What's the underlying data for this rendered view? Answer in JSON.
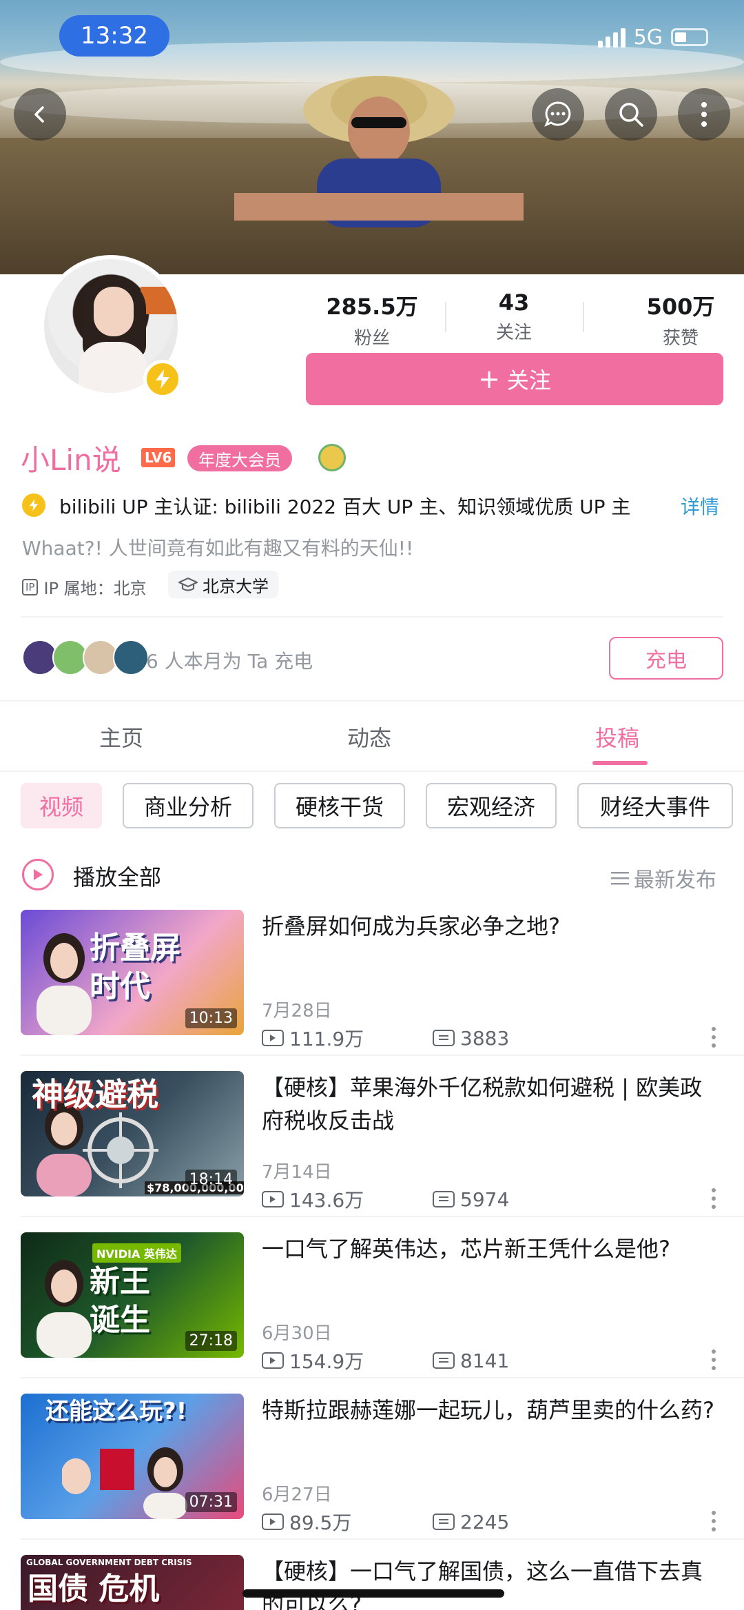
{
  "status_bar": {
    "time": "13:32",
    "network": "5G"
  },
  "header_buttons": [
    "back-icon",
    "message-icon",
    "search-icon",
    "more-vert-icon"
  ],
  "profile": {
    "stats": [
      {
        "value": "285.5万",
        "label": "粉丝"
      },
      {
        "value": "43",
        "label": "关注"
      },
      {
        "value": "500万",
        "label": "获赞"
      }
    ],
    "follow_label": "关注",
    "name": "小Lin说",
    "level": "LV6",
    "vip_label": "年度大会员",
    "certification": "bilibili UP 主认证: bilibili 2022 百大 UP 主、知识领域优质 UP 主",
    "detail_label": "详情",
    "bio": "Whaat?! 人世间竟有如此有趣又有料的天仙!!",
    "ip_badge": "IP",
    "ip_location": "IP 属地：北京",
    "school": "北京大学",
    "charge_text": "6 人本月为 Ta 充电",
    "charge_label": "充电"
  },
  "tabs": [
    {
      "label": "主页",
      "active": false
    },
    {
      "label": "动态",
      "active": false
    },
    {
      "label": "投稿",
      "active": true
    }
  ],
  "chips": [
    {
      "label": "视频",
      "active": true
    },
    {
      "label": "商业分析",
      "active": false
    },
    {
      "label": "硬核干货",
      "active": false
    },
    {
      "label": "宏观经济",
      "active": false
    },
    {
      "label": "财经大事件",
      "active": false
    }
  ],
  "list_header": {
    "play_all": "播放全部",
    "sort": "最新发布"
  },
  "videos": [
    {
      "title": "折叠屏如何成为兵家必争之地?",
      "thumb_text": "折叠屏\n时代",
      "duration": "10:13",
      "date": "7月28日",
      "views": "111.9万",
      "comments": "3883"
    },
    {
      "title": "【硬核】苹果海外千亿税款如何避税 | 欧美政府税收反击战",
      "thumb_text": "神级避税",
      "thumb_caption": "$78,000,000,000",
      "duration": "18:14",
      "date": "7月14日",
      "views": "143.6万",
      "comments": "5974"
    },
    {
      "title": "一口气了解英伟达，芯片新王凭什么是他?",
      "thumb_text": "新王\n诞生",
      "thumb_tag": "NVIDIA 英伟达",
      "duration": "27:18",
      "date": "6月30日",
      "views": "154.9万",
      "comments": "8141"
    },
    {
      "title": "特斯拉跟赫莲娜一起玩儿，葫芦里卖的什么药?",
      "thumb_text": "还能这么玩?!",
      "duration": "07:31",
      "date": "6月27日",
      "views": "89.5万",
      "comments": "2245"
    },
    {
      "title": "【硬核】一口气了解国债，这么一直借下去真的可以么?",
      "thumb_text": "国债 危机",
      "thumb_tag": "GLOBAL GOVERNMENT DEBT CRISIS"
    }
  ],
  "colors": {
    "accent": "#f06fa0",
    "link": "#2f9bd6",
    "status_pill": "#2f6fe4"
  }
}
